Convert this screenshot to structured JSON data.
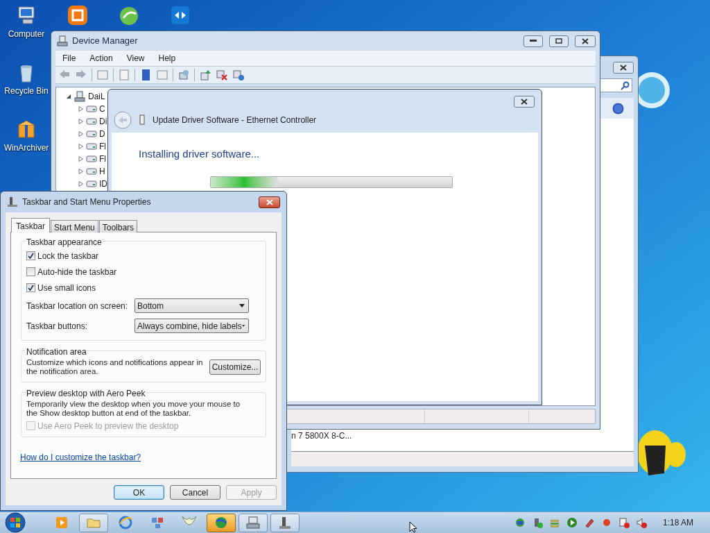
{
  "desktop_icons": [
    {
      "label": "Computer",
      "kind": "computer"
    },
    {
      "label": "Recycle Bin",
      "kind": "bin"
    },
    {
      "label": "WinArchiver",
      "kind": "archive"
    }
  ],
  "top_icons": [
    {
      "kind": "orange"
    },
    {
      "kind": "green"
    },
    {
      "kind": "teal"
    }
  ],
  "background_window": {
    "row_text": "n 7 5800X 8-C..."
  },
  "device_manager": {
    "title": "Device Manager",
    "menu": [
      "File",
      "Action",
      "View",
      "Help"
    ],
    "tree": {
      "label": "DaiL",
      "expanded": true,
      "children": [
        {
          "label": "C",
          "expanded": false
        },
        {
          "label": "Di",
          "expanded": false
        },
        {
          "label": "D",
          "expanded": false
        },
        {
          "label": "Fl",
          "expanded": false
        },
        {
          "label": "Fl",
          "expanded": false
        },
        {
          "label": "H",
          "expanded": false
        },
        {
          "label": "ID",
          "expanded": false
        }
      ]
    }
  },
  "update_driver": {
    "title": "Update Driver Software - Ethernet Controller",
    "heading": "Installing driver software...",
    "progress": {
      "level": 0.28
    }
  },
  "properties": {
    "title": "Taskbar and Start Menu Properties",
    "tabs": [
      {
        "label": "Taskbar",
        "selected": true
      },
      {
        "label": "Start Menu",
        "selected": false
      },
      {
        "label": "Toolbars",
        "selected": false
      }
    ],
    "appearance": {
      "title": "Taskbar appearance",
      "checkboxes": [
        {
          "label": "Lock the taskbar",
          "checked": true
        },
        {
          "label": "Auto-hide the taskbar",
          "checked": false
        },
        {
          "label": "Use small icons",
          "checked": true
        }
      ],
      "dropdowns": [
        {
          "label": "Taskbar location on screen:",
          "value": "Bottom"
        },
        {
          "label": "Taskbar buttons:",
          "value": "Always combine, hide labels"
        }
      ]
    },
    "notification": {
      "title": "Notification area",
      "text": "Customize which icons and notifications appear in the notification area.",
      "button": "Customize..."
    },
    "aero_peek": {
      "title": "Preview desktop with Aero Peek",
      "text": "Temporarily view the desktop when you move your mouse to the Show desktop button at end of the taskbar.",
      "checkbox": {
        "label": "Use Aero Peek to preview the desktop",
        "checked": false,
        "disabled": true
      }
    },
    "help_link": "How do I customize the taskbar?",
    "buttons": [
      {
        "label": "OK",
        "kind": "default",
        "disabled": false
      },
      {
        "label": "Cancel",
        "kind": "normal",
        "disabled": false
      },
      {
        "label": "Apply",
        "kind": "normal",
        "disabled": true
      }
    ]
  },
  "taskbar": {
    "apps": [
      {
        "kind": "media",
        "open": false,
        "selected": false
      },
      {
        "kind": "folder",
        "open": true,
        "selected": false
      },
      {
        "kind": "ie",
        "open": false,
        "selected": false
      },
      {
        "kind": "network",
        "open": false,
        "selected": false
      },
      {
        "kind": "bird",
        "open": false,
        "selected": false
      },
      {
        "kind": "globe",
        "open": true,
        "selected": true
      },
      {
        "kind": "computer",
        "open": true,
        "selected": false
      },
      {
        "kind": "device",
        "open": true,
        "selected": false
      }
    ],
    "clock": "1:18 AM"
  }
}
